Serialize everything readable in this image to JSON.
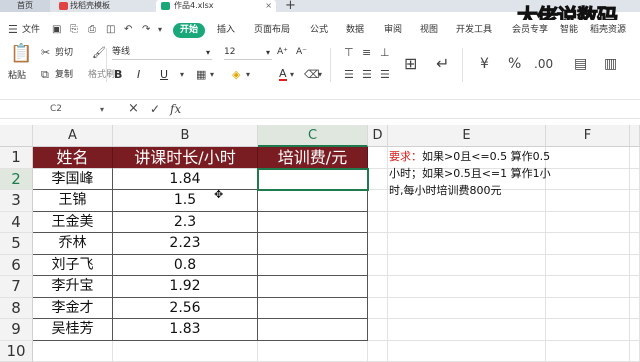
{
  "titlebar": {
    "home_tab": "首页",
    "template_tab": "找稻壳模板",
    "file_tab": "作品4.xlsx",
    "close_glyph": "×",
    "new_tab_glyph": "+"
  },
  "watermark": "大佬说数码",
  "menu": {
    "file": "文件",
    "start": "开始",
    "items": [
      "插入",
      "页面布局",
      "公式",
      "数据",
      "审阅",
      "视图",
      "开发工具",
      "会员专享",
      "智能",
      "稻壳资源"
    ]
  },
  "ribbon": {
    "cut": "剪切",
    "paste": "粘贴",
    "copy": "复制",
    "format_painter": "格式刷",
    "font_name": "等线",
    "font_size": "12",
    "bold": "B",
    "italic": "I",
    "underline": "U",
    "font_color_glyph": "A",
    "grow_font": "A⁺",
    "shrink_font": "A⁻"
  },
  "formula_bar": {
    "cell_ref": "C2",
    "cancel_glyph": "×",
    "confirm_glyph": "✓",
    "fx_label": "fx",
    "value": ""
  },
  "columns": [
    "A",
    "B",
    "C",
    "D",
    "E",
    "F"
  ],
  "selected_cell": "C2",
  "table": {
    "headers": [
      "姓名",
      "讲课时长/小时",
      "培训费/元"
    ],
    "rows": [
      {
        "row": "2",
        "name": "李国峰",
        "hours": "1.84",
        "fee": ""
      },
      {
        "row": "3",
        "name": "王锦",
        "hours": "1.5",
        "fee": ""
      },
      {
        "row": "4",
        "name": "王金美",
        "hours": "2.3",
        "fee": ""
      },
      {
        "row": "5",
        "name": "乔林",
        "hours": "2.23",
        "fee": ""
      },
      {
        "row": "6",
        "name": "刘子飞",
        "hours": "0.8",
        "fee": ""
      },
      {
        "row": "7",
        "name": "李升宝",
        "hours": "1.92",
        "fee": ""
      },
      {
        "row": "8",
        "name": "李金才",
        "hours": "2.56",
        "fee": ""
      },
      {
        "row": "9",
        "name": "吴桂芳",
        "hours": "1.83",
        "fee": ""
      }
    ]
  },
  "note": {
    "label": "要求：",
    "text": "如果>0且<=0.5 算作0.5小时；如果>0.5且<=1 算作1小时,每小时培训费800元"
  },
  "colors": {
    "header_fill": "#7a1d22",
    "accent_green": "#1f7a4d",
    "start_button": "#1aa87a",
    "requirement_red": "#d82020"
  }
}
